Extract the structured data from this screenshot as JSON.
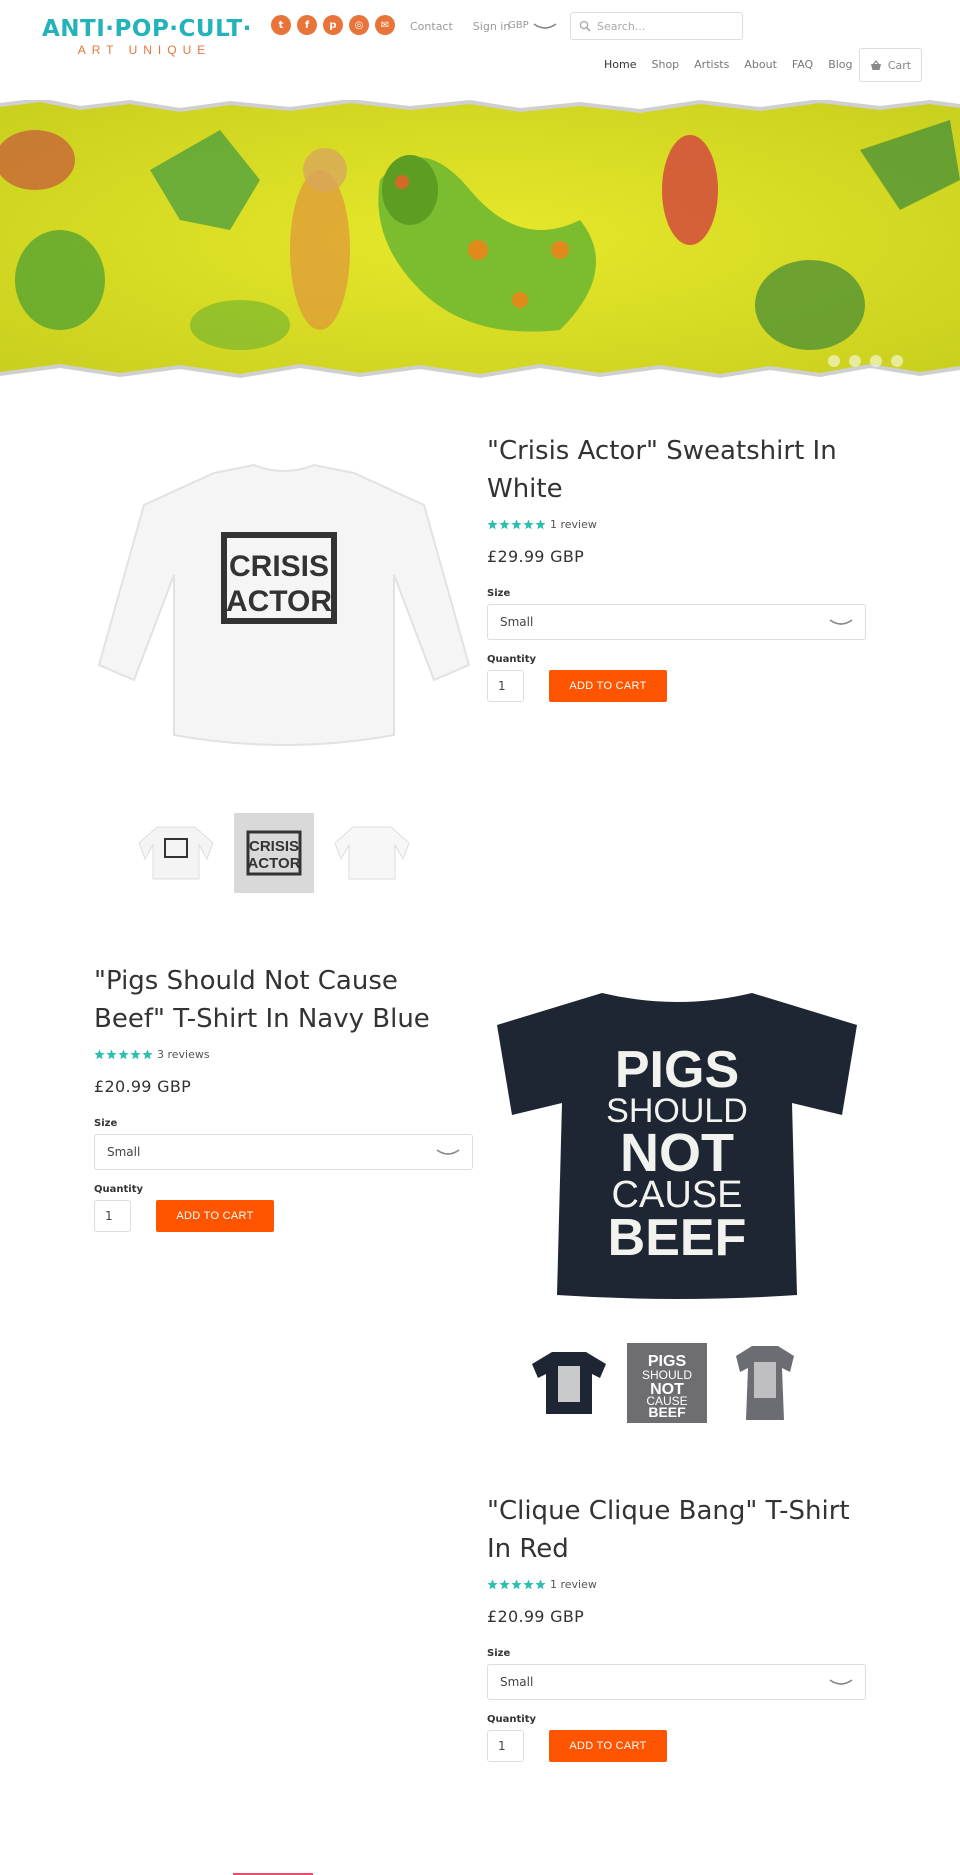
{
  "header": {
    "logo_main": "ANTI·POP·CULT·",
    "logo_sub": "ART UNIQUE",
    "social": [
      {
        "icon": "twitter-icon",
        "glyph": "t"
      },
      {
        "icon": "facebook-icon",
        "glyph": "f"
      },
      {
        "icon": "pinterest-icon",
        "glyph": "p"
      },
      {
        "icon": "instagram-icon",
        "glyph": "◎"
      },
      {
        "icon": "email-icon",
        "glyph": "✉"
      }
    ],
    "contact": "Contact",
    "sign_in": "Sign in",
    "currency": "GBP",
    "search_placeholder": "Search...",
    "nav": [
      "Home",
      "Shop",
      "Artists",
      "About",
      "FAQ",
      "Blog"
    ],
    "cart": "Cart"
  },
  "banner": {
    "slides": 4
  },
  "products": [
    {
      "title": "\"Crisis Actor\" Sweatshirt In White",
      "reviews": "1 review",
      "rating": 5,
      "price": "£29.99 GBP",
      "size_label": "Size",
      "size": "Small",
      "qty_label": "Quantity",
      "qty": "1",
      "add": "ADD TO CART",
      "print_text": [
        "CRISIS",
        "ACTOR"
      ]
    },
    {
      "title": "\"Pigs Should Not Cause Beef\" T-Shirt In Navy Blue",
      "reviews": "3 reviews",
      "rating": 5,
      "price": "£20.99 GBP",
      "size_label": "Size",
      "size": "Small",
      "qty_label": "Quantity",
      "qty": "1",
      "add": "ADD TO CART",
      "print_text": [
        "PIGS",
        "SHOULD",
        "NOT",
        "CAUSE",
        "BEEF"
      ]
    },
    {
      "title": "\"Clique Clique Bang\" T-Shirt In Red",
      "reviews": "1 review",
      "rating": 5,
      "price": "£20.99 GBP",
      "size_label": "Size",
      "size": "Small",
      "qty_label": "Quantity",
      "qty": "1",
      "add": "ADD TO CART"
    }
  ],
  "colors": {
    "accent": "#ff5500",
    "logo_teal": "#22b3bb",
    "logo_orange": "#e8743a",
    "star": "#2bbfb0",
    "navy": "#1f2633"
  }
}
